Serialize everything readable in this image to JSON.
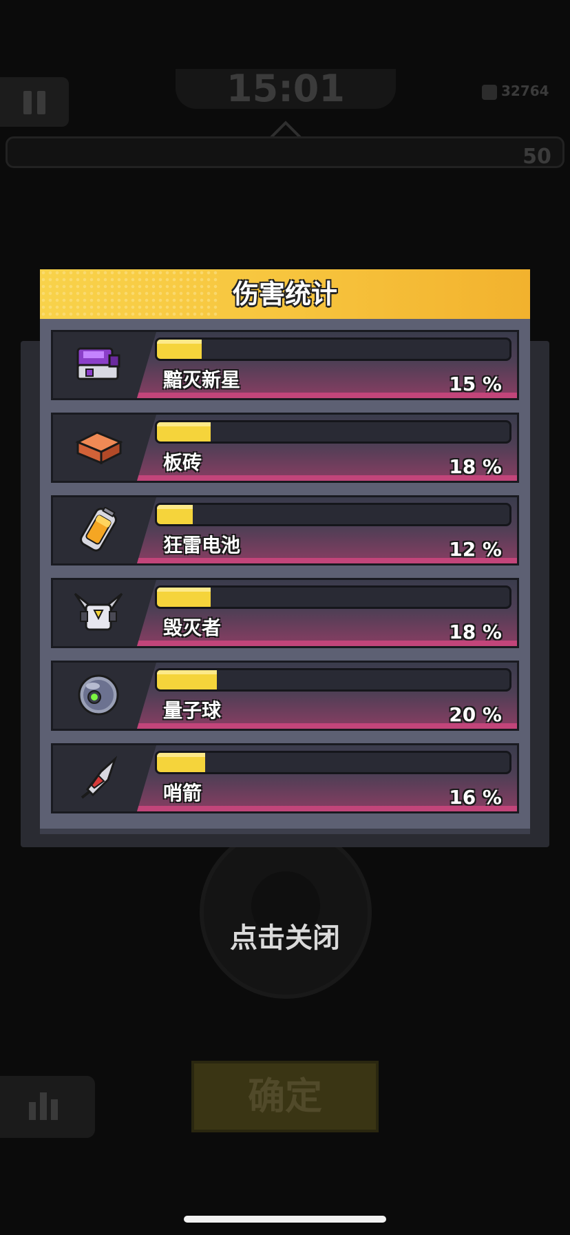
{
  "hud": {
    "timer": "15:01",
    "coins": "32764",
    "level": "50"
  },
  "dialog": {
    "title": "伤害统计",
    "rows": [
      {
        "name": "黯灭新星",
        "percent_label": "15 %",
        "percent": 15,
        "icon": "purple-gadget-icon"
      },
      {
        "name": "板砖",
        "percent_label": "18 %",
        "percent": 18,
        "icon": "brick-icon"
      },
      {
        "name": "狂雷电池",
        "percent_label": "12 %",
        "percent": 12,
        "icon": "battery-icon"
      },
      {
        "name": "毁灭者",
        "percent_label": "18 %",
        "percent": 18,
        "icon": "destroyer-robot-icon"
      },
      {
        "name": "量子球",
        "percent_label": "20 %",
        "percent": 20,
        "icon": "quantum-orb-icon"
      },
      {
        "name": "哨箭",
        "percent_label": "16 %",
        "percent": 16,
        "icon": "arrow-dart-icon"
      }
    ]
  },
  "tap_to_close": "点击关闭",
  "confirm_label": "确定",
  "colors": {
    "header_yellow": "#f7c53e",
    "bar_fill": "#f5d43b",
    "panel": "#5d6073",
    "row_accent": "#c2457a"
  }
}
